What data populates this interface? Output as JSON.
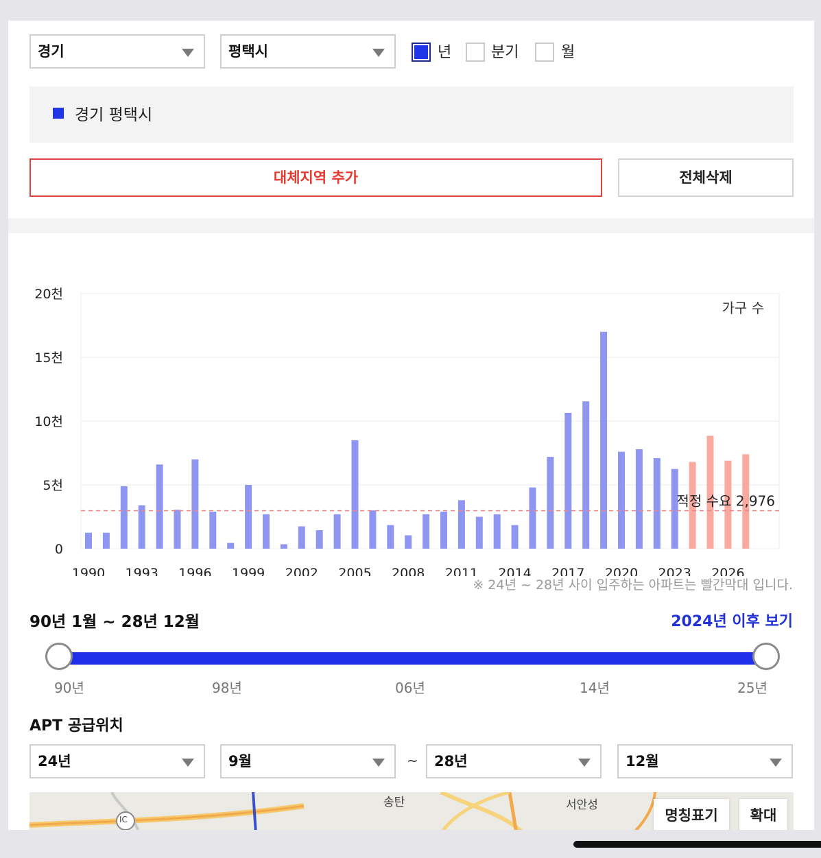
{
  "filters": {
    "province": "경기",
    "city": "평택시",
    "period_options": [
      {
        "label": "년",
        "checked": true
      },
      {
        "label": "분기",
        "checked": false
      },
      {
        "label": "월",
        "checked": false
      }
    ]
  },
  "legend": {
    "label": "경기 평택시",
    "color": "#1f36e8"
  },
  "buttons": {
    "add_region": "대체지역 추가",
    "delete_all": "전체삭제"
  },
  "chart_data": {
    "type": "bar",
    "unit_label": "가구 수",
    "y_ticks": [
      "20천",
      "15천",
      "10천",
      "5천",
      "0"
    ],
    "ylim": [
      0,
      20000
    ],
    "x_tick_labels": [
      "1990",
      "1993",
      "1996",
      "1999",
      "2002",
      "2005",
      "2008",
      "2011",
      "2014",
      "2017",
      "2020",
      "2023",
      "2026"
    ],
    "years": [
      1990,
      1991,
      1992,
      1993,
      1994,
      1995,
      1996,
      1997,
      1998,
      1999,
      2000,
      2001,
      2002,
      2003,
      2004,
      2005,
      2006,
      2007,
      2008,
      2009,
      2010,
      2011,
      2012,
      2013,
      2014,
      2015,
      2016,
      2017,
      2018,
      2019,
      2020,
      2021,
      2022,
      2023,
      2024,
      2025,
      2026,
      2027
    ],
    "values": [
      1250,
      1250,
      4900,
      3400,
      6600,
      3050,
      7000,
      2900,
      450,
      5000,
      2700,
      350,
      1750,
      1450,
      2700,
      8500,
      3000,
      1850,
      1050,
      2700,
      2900,
      3800,
      2500,
      2700,
      1850,
      4800,
      7200,
      10650,
      11550,
      17000,
      7600,
      7800,
      7100,
      6250,
      6800,
      8850,
      6900,
      7400
    ],
    "colors": {
      "past": "#8e96f2",
      "future": "#f8aaa0"
    },
    "future_from": 2024,
    "reference_line": {
      "value": 2976,
      "label": "적정 수요 2,976",
      "color": "#f08585"
    }
  },
  "note": "※ 24년 ~ 28년 사이 입주하는 아파트는 빨간막대 입니다.",
  "range": {
    "title": "90년 1월 ~ 28년 12월",
    "link": "2024년 이후 보기",
    "ticks": [
      "90년",
      "98년",
      "06년",
      "14년",
      "25년"
    ]
  },
  "supply": {
    "title": "APT 공급위치",
    "from_year": "24년",
    "from_month": "9월",
    "separator": "~",
    "to_year": "28년",
    "to_month": "12월"
  },
  "map": {
    "labels": [
      "송탄",
      "서안성",
      "IC"
    ],
    "btn_names": "명칭표기",
    "btn_zoom": "확대"
  }
}
